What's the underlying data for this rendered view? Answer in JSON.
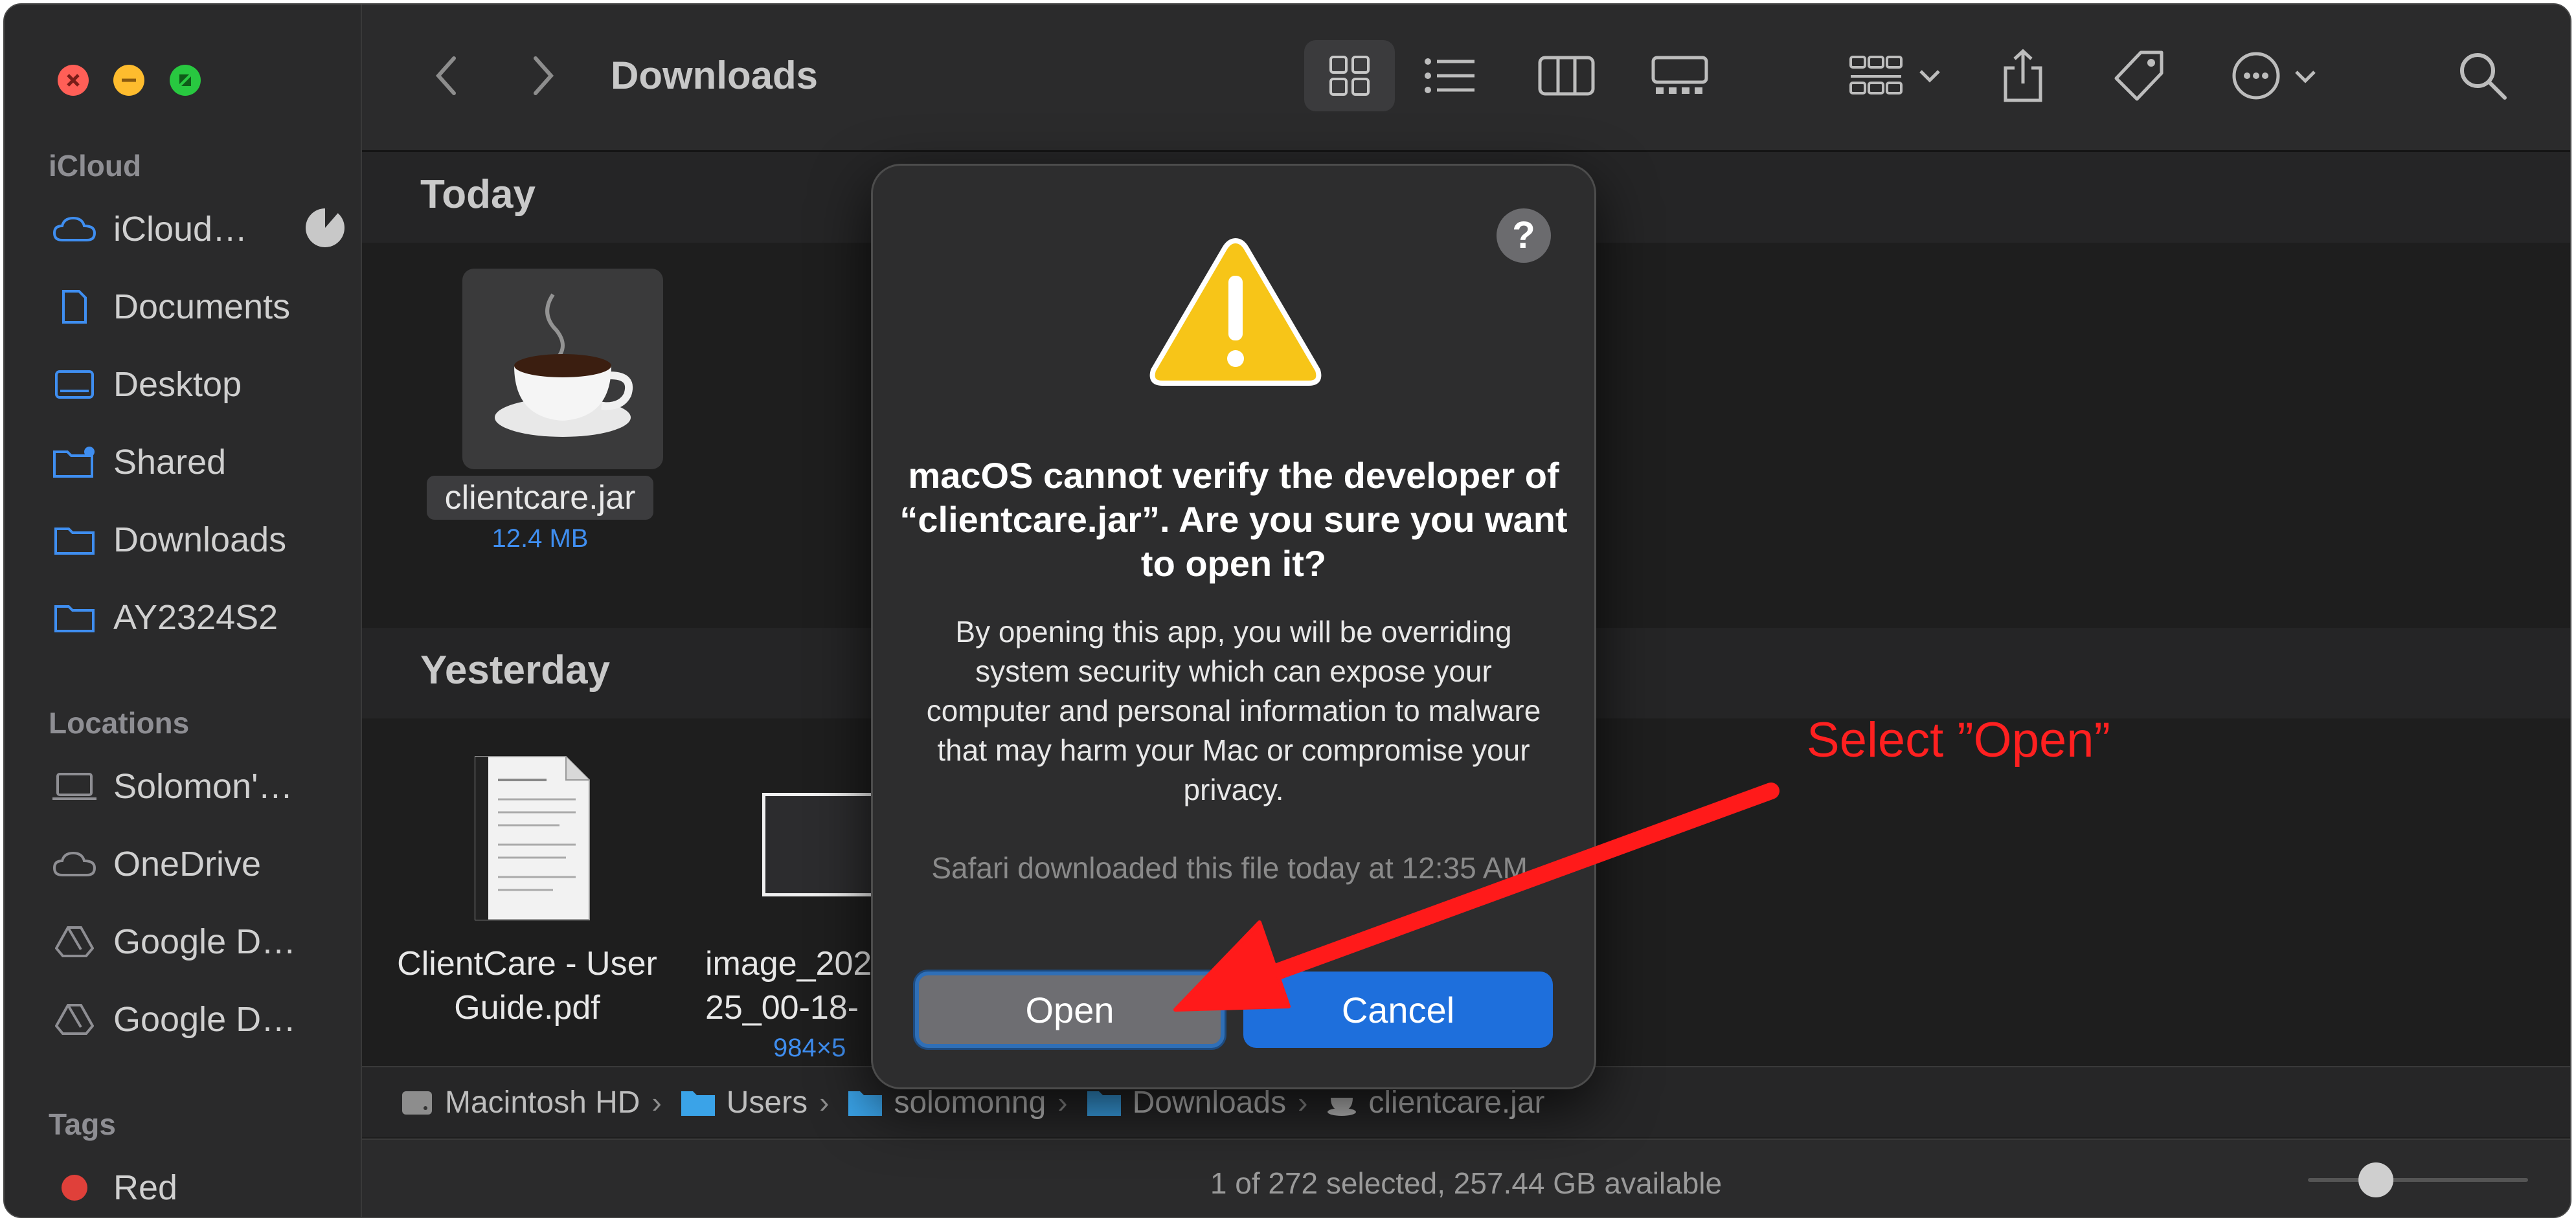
{
  "window": {
    "title": "Downloads"
  },
  "sidebar": {
    "sections": {
      "icloud": "iCloud",
      "locations": "Locations",
      "tags": "Tags"
    },
    "icloud_items": [
      {
        "label": "iCloud…",
        "icon": "cloud-icon"
      },
      {
        "label": "Documents",
        "icon": "document-icon"
      },
      {
        "label": "Desktop",
        "icon": "desktop-icon"
      },
      {
        "label": "Shared",
        "icon": "shared-folder-icon"
      },
      {
        "label": "Downloads",
        "icon": "folder-icon"
      },
      {
        "label": "AY2324S2",
        "icon": "folder-icon"
      }
    ],
    "location_items": [
      {
        "label": "Solomon'…",
        "icon": "laptop-icon"
      },
      {
        "label": "OneDrive",
        "icon": "cloud-icon"
      },
      {
        "label": "Google D…",
        "icon": "google-drive-icon"
      },
      {
        "label": "Google D…",
        "icon": "google-drive-icon"
      }
    ],
    "tag_items": [
      {
        "label": "Red",
        "color": "#e0403a"
      }
    ]
  },
  "content": {
    "today": {
      "title": "Today",
      "file": {
        "name": "clientcare.jar",
        "size": "12.4 MB"
      }
    },
    "yesterday": {
      "title": "Yesterday",
      "files": [
        {
          "name_line1": "ClientCare - User",
          "name_line2": "Guide.pdf"
        },
        {
          "name_line1": "image_202",
          "name_line2": "25_00-18-",
          "meta": "984×5"
        }
      ]
    }
  },
  "pathbar": {
    "items": [
      "Macintosh HD",
      "Users",
      "solomonng",
      "Downloads",
      "clientcare.jar"
    ]
  },
  "status": {
    "text": "1 of 272 selected, 257.44 GB available"
  },
  "dialog": {
    "title": "macOS cannot verify the developer of “clientcare.jar”. Are you sure you want to open it?",
    "body": "By opening this app, you will be overriding system security which can expose your computer and personal information to malware that may harm your Mac or compromise your privacy.",
    "footnote": "Safari downloaded this file today at 12:35 AM.",
    "help_label": "?",
    "open_label": "Open",
    "cancel_label": "Cancel"
  },
  "annotation": {
    "text": "Select ”Open”",
    "color": "#ff2020"
  },
  "colors": {
    "accent": "#1e6fdc",
    "annotation": "#ff2020"
  }
}
